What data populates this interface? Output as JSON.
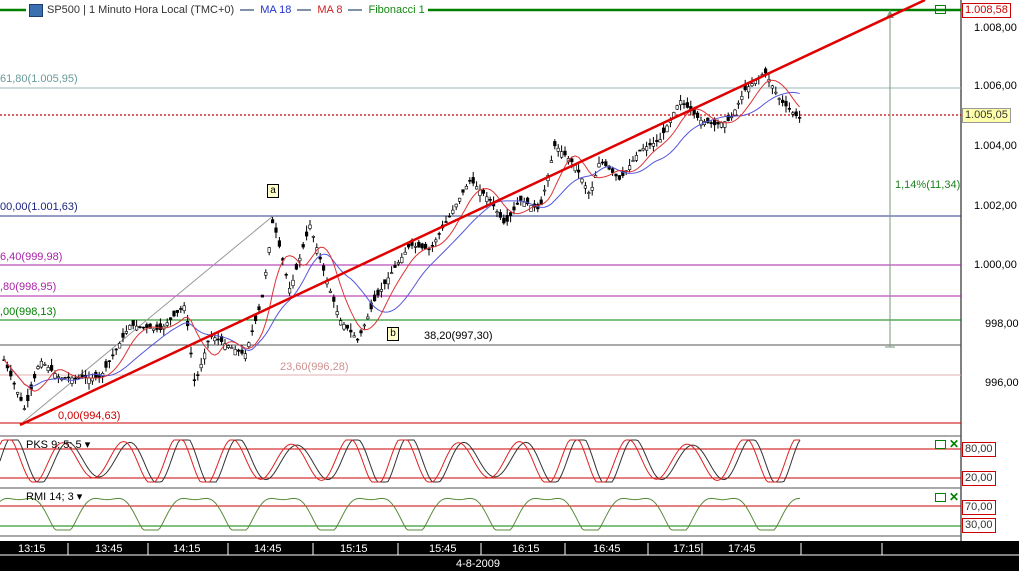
{
  "header": {
    "title": "SP500 | 1 Minuto Hora Local (TMC+0)",
    "indicators": [
      {
        "label": "MA 18",
        "color": "#2233cc"
      },
      {
        "label": "MA 8",
        "color": "#cc2222"
      },
      {
        "label": "Fibonacci 1",
        "color": "#118811"
      }
    ]
  },
  "price_axis": {
    "ticks": [
      "1.008,00",
      "1.006,00",
      "1.004,00",
      "1.002,00",
      "1.000,00",
      "998,00",
      "996,00"
    ],
    "top_marker": "1.008,58",
    "current_price": "1.005,05"
  },
  "fibonacci_labels": [
    {
      "text": "61,80(1.005,95)",
      "color": "#6a9a9a"
    },
    {
      "text": "00,00(1.001,63)",
      "color": "#1a237e"
    },
    {
      "text": "6,40(999,98)",
      "color": "#aa22aa"
    },
    {
      "text": ",80(998,95)",
      "color": "#aa22aa"
    },
    {
      "text": ",00(998,13)",
      "color": "#008000"
    },
    {
      "text": "38,20(997,30)",
      "color": "#000000"
    },
    {
      "text": "23,60(996,28)",
      "color": "#d09090"
    },
    {
      "text": "0,00(994,63)",
      "color": "#cc0000"
    }
  ],
  "measure_label": "1,14%(11,34)",
  "wave_markers": {
    "a": "a",
    "b": "b"
  },
  "pks": {
    "label": "PKS 9; 5; 5",
    "levels": [
      "80,00",
      "20,00"
    ]
  },
  "rmi": {
    "label": "RMI 14; 3",
    "levels": [
      "70,00",
      "30,00"
    ]
  },
  "time_axis": {
    "labels": [
      "13:15",
      "13:45",
      "14:15",
      "14:45",
      "15:15",
      "15:45",
      "16:15",
      "16:45",
      "17:15",
      "17:45"
    ],
    "date": "4-8-2009"
  },
  "colors": {
    "trendline": "#e00000",
    "ma18": "#5555dd",
    "ma8": "#dd3333",
    "fib_top_border": "#008000",
    "axis_bg": "#000000"
  }
}
